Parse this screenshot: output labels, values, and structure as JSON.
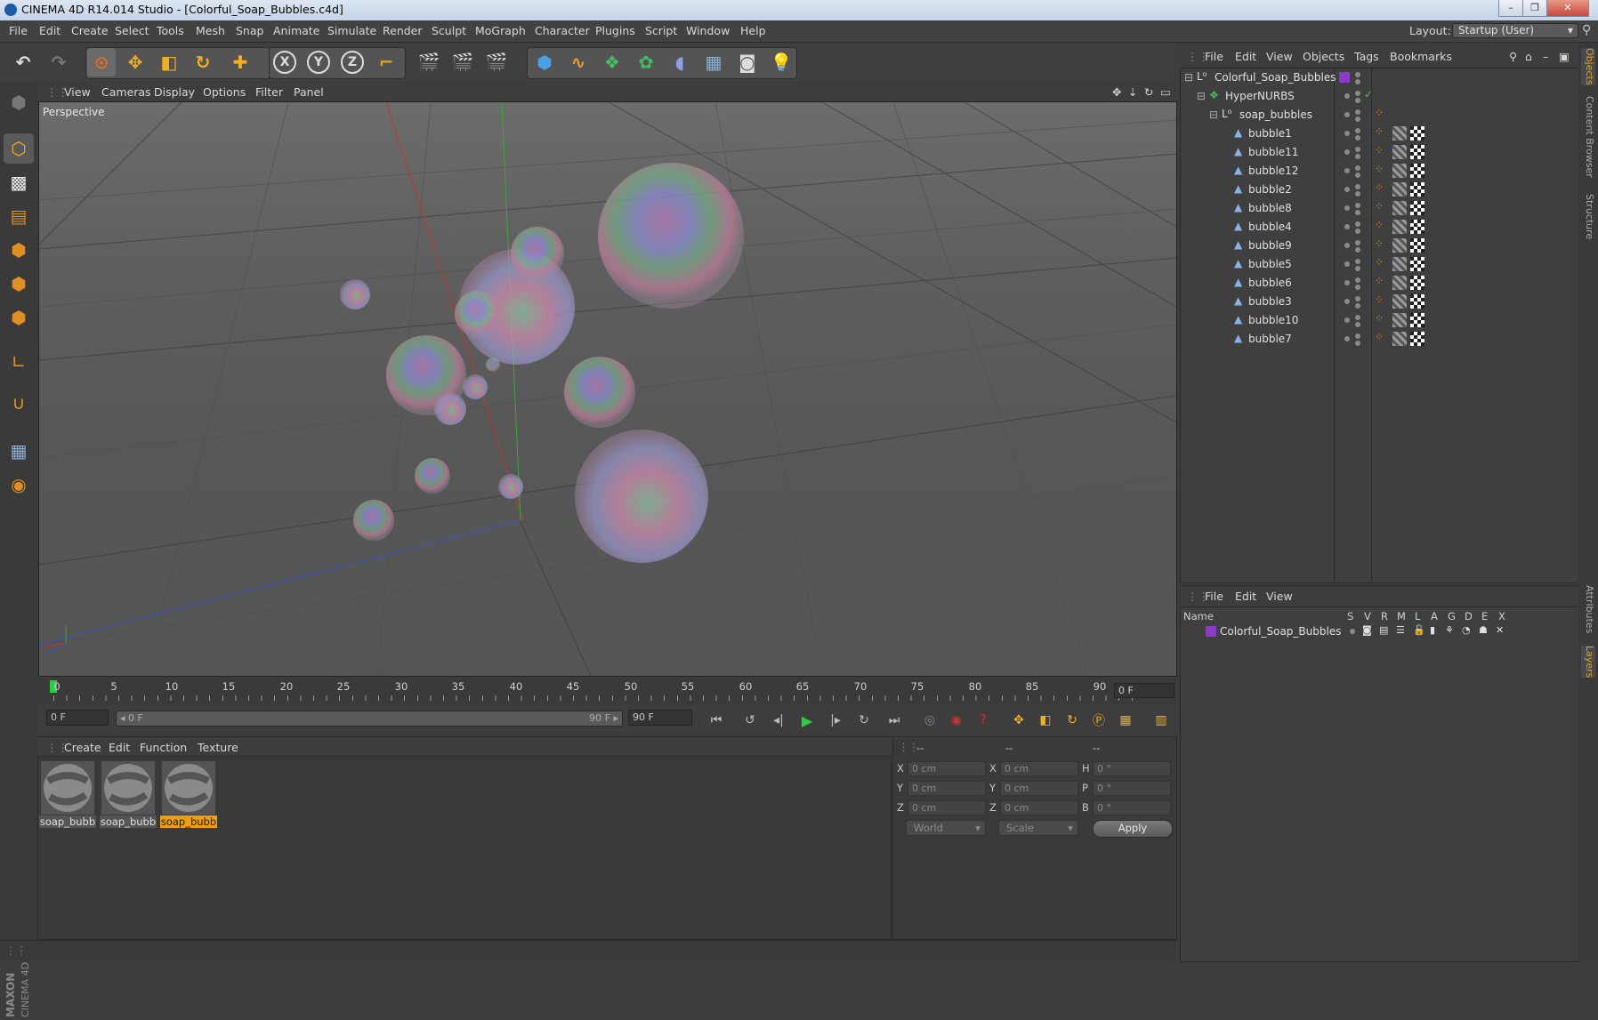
{
  "window": {
    "title": "CINEMA 4D R14.014 Studio - [Colorful_Soap_Bubbles.c4d]",
    "controls": [
      "–",
      "❐",
      "✕"
    ]
  },
  "menubar": {
    "items": [
      "File",
      "Edit",
      "Create",
      "Select",
      "Tools",
      "Mesh",
      "Snap",
      "Animate",
      "Simulate",
      "Render",
      "Sculpt",
      "MoGraph",
      "Character",
      "Plugins",
      "Script",
      "Window",
      "Help"
    ],
    "layout_label": "Layout:",
    "layout_value": "Startup (User)"
  },
  "toolbar": {
    "axis_labels": [
      "X",
      "Y",
      "Z"
    ]
  },
  "viewport": {
    "menu": [
      "View",
      "Cameras",
      "Display",
      "Options",
      "Filter",
      "Panel"
    ],
    "camera_label": "Perspective"
  },
  "timeline": {
    "ticks": [
      "0",
      "5",
      "10",
      "15",
      "20",
      "25",
      "30",
      "35",
      "40",
      "45",
      "50",
      "55",
      "60",
      "65",
      "70",
      "75",
      "80",
      "85",
      "90"
    ],
    "current_frame": "0 F"
  },
  "transport": {
    "start_field": "0 F",
    "range_start": "◂ 0 F",
    "range_end": "90 F ▸",
    "end_field": "90 F"
  },
  "materials": {
    "menu": [
      "Create",
      "Edit",
      "Function",
      "Texture"
    ],
    "items": [
      {
        "label": "soap_bubb",
        "selected": false
      },
      {
        "label": "soap_bubb",
        "selected": false
      },
      {
        "label": "soap_bubb",
        "selected": true
      }
    ]
  },
  "coordinates": {
    "headers": [
      "--",
      "--",
      "--"
    ],
    "rows": [
      {
        "axis1": "X",
        "val1": "0 cm",
        "axis2": "X",
        "val2": "0 cm",
        "axis3": "H",
        "val3": "0 °"
      },
      {
        "axis1": "Y",
        "val1": "0 cm",
        "axis2": "Y",
        "val2": "0 cm",
        "axis3": "P",
        "val3": "0 °"
      },
      {
        "axis1": "Z",
        "val1": "0 cm",
        "axis2": "Z",
        "val2": "0 cm",
        "axis3": "B",
        "val3": "0 °"
      }
    ],
    "space": "World",
    "mode": "Scale",
    "apply_label": "Apply"
  },
  "object_manager": {
    "menu": [
      "File",
      "Edit",
      "View",
      "Objects",
      "Tags",
      "Bookmarks"
    ],
    "objects": [
      {
        "name": "Colorful_Soap_Bubbles",
        "depth": 0
      },
      {
        "name": "HyperNURBS",
        "depth": 1
      },
      {
        "name": "soap_bubbles",
        "depth": 2
      },
      {
        "name": "bubble1",
        "depth": 3
      },
      {
        "name": "bubble11",
        "depth": 3
      },
      {
        "name": "bubble12",
        "depth": 3
      },
      {
        "name": "bubble2",
        "depth": 3
      },
      {
        "name": "bubble8",
        "depth": 3
      },
      {
        "name": "bubble4",
        "depth": 3
      },
      {
        "name": "bubble9",
        "depth": 3
      },
      {
        "name": "bubble5",
        "depth": 3
      },
      {
        "name": "bubble6",
        "depth": 3
      },
      {
        "name": "bubble3",
        "depth": 3
      },
      {
        "name": "bubble10",
        "depth": 3
      },
      {
        "name": "bubble7",
        "depth": 3
      }
    ]
  },
  "layers": {
    "menu": [
      "File",
      "Edit",
      "View"
    ],
    "columns": [
      "Name",
      "S",
      "V",
      "R",
      "M",
      "L",
      "A",
      "G",
      "D",
      "E",
      "X"
    ],
    "rows": [
      {
        "name": "Colorful_Soap_Bubbles",
        "color": "#8a3ac8"
      }
    ]
  },
  "right_tabs": [
    "Objects",
    "Content Browser",
    "Structure",
    "Attributes",
    "Layers"
  ],
  "branding": "MAXON CINEMA 4D",
  "colors": {
    "accent_orange": "#f0a000",
    "layer_purple": "#8a3ac8",
    "axis_x": "#c0392b",
    "axis_y": "#3aa83a",
    "axis_z": "#3a55c8"
  }
}
